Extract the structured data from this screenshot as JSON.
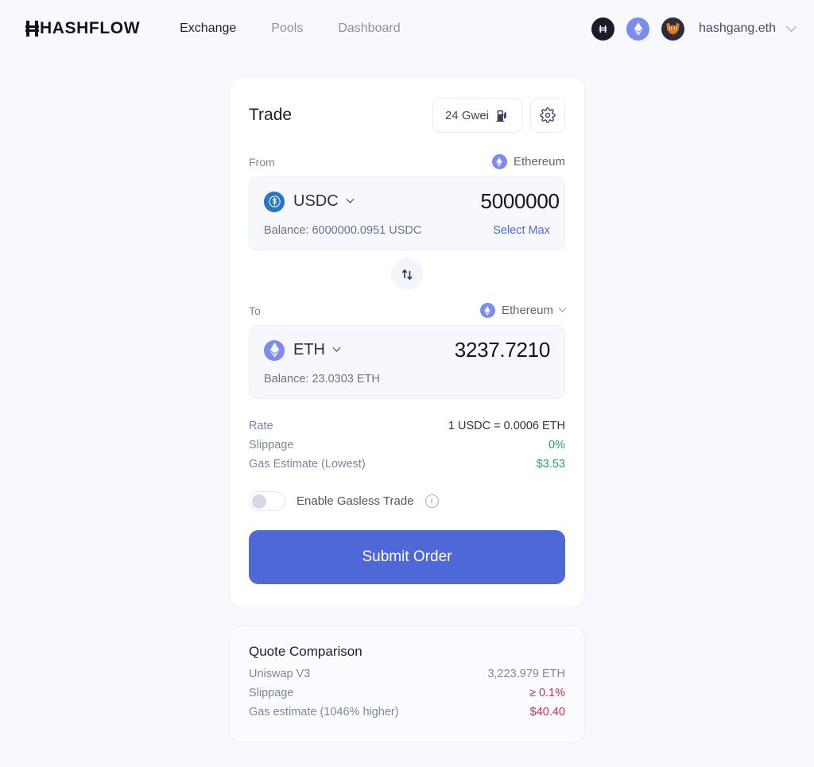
{
  "header": {
    "logo": "HASHFLOW",
    "nav": [
      {
        "label": "Exchange",
        "active": true
      },
      {
        "label": "Pools",
        "active": false
      },
      {
        "label": "Dashboard",
        "active": false
      }
    ],
    "badges": [
      {
        "name": "hashflow-network-badge",
        "glyph": "H"
      },
      {
        "name": "ethereum-network-badge",
        "glyph": "ethereum-diamond"
      }
    ],
    "account": "hashgang.eth",
    "account_avatar": "metamask-fox-avatar"
  },
  "trade": {
    "title": "Trade",
    "gas_price": "24 Gwei",
    "gas_icon": "gas-pump-icon",
    "settings_icon": "gear-icon",
    "from": {
      "label": "From",
      "network": "Ethereum",
      "token": "USDC",
      "amount": "5000000",
      "balance": "Balance: 6000000.0951 USDC",
      "select_max": "Select Max"
    },
    "swap_icon": "swap-arrows-icon",
    "to": {
      "label": "To",
      "network": "Ethereum",
      "token": "ETH",
      "amount": "3237.7210",
      "balance": "Balance: 23.0303 ETH"
    },
    "details": [
      {
        "key": "Rate",
        "value": "1 USDC = 0.0006 ETH",
        "tone": "neutral"
      },
      {
        "key": "Slippage",
        "value": "0%",
        "tone": "green"
      },
      {
        "key": "Gas Estimate (Lowest)",
        "value": "$3.53",
        "tone": "green"
      }
    ],
    "gasless": {
      "label": "Enable Gasless Trade",
      "enabled": false,
      "info_icon": "info-icon"
    },
    "submit_label": "Submit Order"
  },
  "quote_comparison": {
    "title": "Quote Comparison",
    "rows": [
      {
        "key": "Uniswap V3",
        "value": "3,223.979 ETH",
        "tone": "neutral"
      },
      {
        "key": "Slippage",
        "value": "≥ 0.1%",
        "tone": "red"
      },
      {
        "key": "Gas estimate (1046% higher)",
        "value": "$40.40",
        "tone": "red"
      }
    ]
  },
  "colors": {
    "accent": "#4e68d8",
    "background": "#f8f9fe",
    "positive": "#2f9e63",
    "negative": "#c0304f",
    "usdc": "#2775ca",
    "eth": "#7b8cf0"
  }
}
